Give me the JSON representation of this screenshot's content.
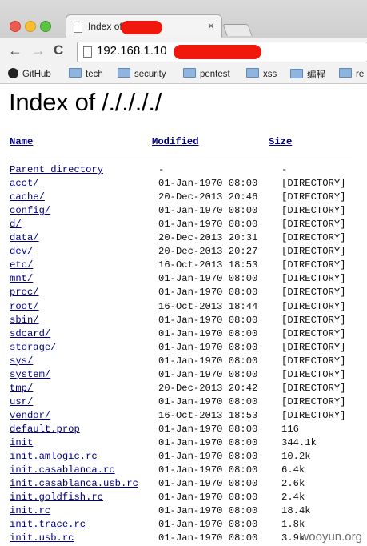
{
  "browser": {
    "tab_title": "Index of",
    "tab_close": "×",
    "url": "192.168.1.10",
    "nav": {
      "back": "←",
      "forward": "→",
      "reload": "C"
    },
    "bookmarks": [
      {
        "label": "GitHub",
        "icon": "github-icon"
      },
      {
        "label": "tech",
        "icon": "folder-icon"
      },
      {
        "label": "security",
        "icon": "folder-icon"
      },
      {
        "label": "pentest",
        "icon": "folder-icon"
      },
      {
        "label": "xss",
        "icon": "folder-icon"
      },
      {
        "label": "编程",
        "icon": "folder-icon"
      },
      {
        "label": "re",
        "icon": "folder-icon"
      }
    ]
  },
  "page": {
    "title": "Index of /././././",
    "headers": {
      "name": "Name",
      "modified": "Modified",
      "size": "Size"
    },
    "rows": [
      {
        "name": "Parent directory",
        "modified": "-",
        "size": "-"
      },
      {
        "name": "acct/",
        "modified": "01-Jan-1970 08:00",
        "size": "[DIRECTORY]"
      },
      {
        "name": "cache/",
        "modified": "20-Dec-2013 20:46",
        "size": "[DIRECTORY]"
      },
      {
        "name": "config/",
        "modified": "01-Jan-1970 08:00",
        "size": "[DIRECTORY]"
      },
      {
        "name": "d/",
        "modified": "01-Jan-1970 08:00",
        "size": "[DIRECTORY]"
      },
      {
        "name": "data/",
        "modified": "20-Dec-2013 20:31",
        "size": "[DIRECTORY]"
      },
      {
        "name": "dev/",
        "modified": "20-Dec-2013 20:27",
        "size": "[DIRECTORY]"
      },
      {
        "name": "etc/",
        "modified": "16-Oct-2013 18:53",
        "size": "[DIRECTORY]"
      },
      {
        "name": "mnt/",
        "modified": "01-Jan-1970 08:00",
        "size": "[DIRECTORY]"
      },
      {
        "name": "proc/",
        "modified": "01-Jan-1970 08:00",
        "size": "[DIRECTORY]"
      },
      {
        "name": "root/",
        "modified": "16-Oct-2013 18:44",
        "size": "[DIRECTORY]"
      },
      {
        "name": "sbin/",
        "modified": "01-Jan-1970 08:00",
        "size": "[DIRECTORY]"
      },
      {
        "name": "sdcard/",
        "modified": "01-Jan-1970 08:00",
        "size": "[DIRECTORY]"
      },
      {
        "name": "storage/",
        "modified": "01-Jan-1970 08:00",
        "size": "[DIRECTORY]"
      },
      {
        "name": "sys/",
        "modified": "01-Jan-1970 08:00",
        "size": "[DIRECTORY]"
      },
      {
        "name": "system/",
        "modified": "01-Jan-1970 08:00",
        "size": "[DIRECTORY]"
      },
      {
        "name": "tmp/",
        "modified": "20-Dec-2013 20:42",
        "size": "[DIRECTORY]"
      },
      {
        "name": "usr/",
        "modified": "01-Jan-1970 08:00",
        "size": "[DIRECTORY]"
      },
      {
        "name": "vendor/",
        "modified": "16-Oct-2013 18:53",
        "size": "[DIRECTORY]"
      },
      {
        "name": "default.prop",
        "modified": "01-Jan-1970 08:00",
        "size": "116"
      },
      {
        "name": "init",
        "modified": "01-Jan-1970 08:00",
        "size": "344.1k"
      },
      {
        "name": "init.amlogic.rc",
        "modified": "01-Jan-1970 08:00",
        "size": "10.2k"
      },
      {
        "name": "init.casablanca.rc",
        "modified": "01-Jan-1970 08:00",
        "size": "6.4k"
      },
      {
        "name": "init.casablanca.usb.rc",
        "modified": "01-Jan-1970 08:00",
        "size": "2.6k"
      },
      {
        "name": "init.goldfish.rc",
        "modified": "01-Jan-1970 08:00",
        "size": "2.4k"
      },
      {
        "name": "init.rc",
        "modified": "01-Jan-1970 08:00",
        "size": "18.4k"
      },
      {
        "name": "init.trace.rc",
        "modified": "01-Jan-1970 08:00",
        "size": "1.8k"
      },
      {
        "name": "init.usb.rc",
        "modified": "01-Jan-1970 08:00",
        "size": "3.9k"
      }
    ]
  },
  "watermark": "wooyun.org",
  "colors": {
    "link": "#00007f",
    "redaction": "#f0170c"
  }
}
